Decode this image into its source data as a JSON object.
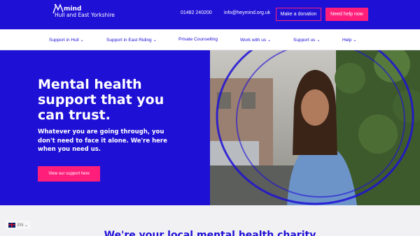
{
  "header": {
    "logo_word": "mind",
    "logo_sub": "Hull and East Yorkshire",
    "phone": "01482 240200",
    "email": "info@heymind.org.uk",
    "donate_label": "Make a donation",
    "help_label": "Need help now"
  },
  "nav": {
    "items": [
      {
        "label": "Support in Hull ⌄"
      },
      {
        "label": "Support in East Riding ⌄"
      },
      {
        "label": "Private Counselling"
      },
      {
        "label": "Work with us ⌄"
      },
      {
        "label": "Support us ⌄"
      },
      {
        "label": "Help ⌄"
      }
    ]
  },
  "hero": {
    "title": "Mental health support that you can trust.",
    "text": "Whatever you are going through, you don't need to face it alone. We're here when you need us.",
    "button_label": "View our support here"
  },
  "band": {
    "title": "We're your local mental health charity"
  },
  "language": {
    "label": "EN ⌄"
  },
  "colors": {
    "brand_blue": "#1f10d6",
    "accent_pink": "#ff1f7a"
  }
}
